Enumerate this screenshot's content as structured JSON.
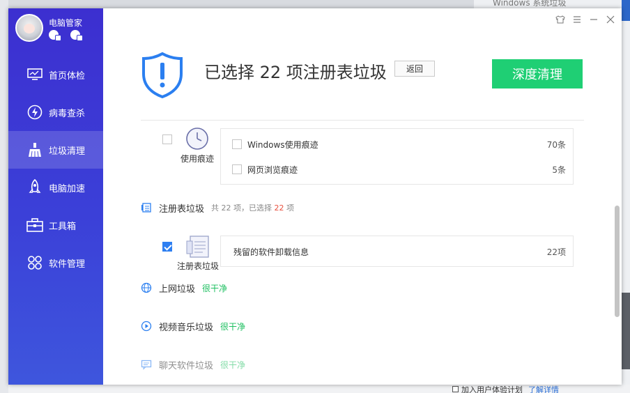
{
  "app": {
    "name": "电脑管家",
    "accent": "#3b3ad4",
    "green": "#1fcf74"
  },
  "sidebar": {
    "items": [
      {
        "label": "首页体检",
        "icon": "monitor-icon"
      },
      {
        "label": "病毒查杀",
        "icon": "lightning-icon"
      },
      {
        "label": "垃圾清理",
        "icon": "broom-icon",
        "active": true
      },
      {
        "label": "电脑加速",
        "icon": "rocket-icon"
      },
      {
        "label": "工具箱",
        "icon": "toolbox-icon"
      },
      {
        "label": "软件管理",
        "icon": "apps-icon"
      }
    ]
  },
  "header": {
    "title": "已选择 22 项注册表垃圾",
    "back_label": "返回",
    "deep_clean_label": "深度清理"
  },
  "usage_traces": {
    "label": "使用痕迹",
    "rows": [
      {
        "name": "Windows使用痕迹",
        "count": "70条"
      },
      {
        "name": "网页浏览痕迹",
        "count": "5条"
      }
    ]
  },
  "registry": {
    "title": "注册表垃圾",
    "summary_prefix": "共 22 项，已选择",
    "selected": "22",
    "summary_suffix": "项",
    "sub_label": "注册表垃圾",
    "rows": [
      {
        "name": "残留的软件卸载信息",
        "count": "22项"
      }
    ]
  },
  "categories": [
    {
      "name": "上网垃圾",
      "status": "很干净",
      "icon": "globe-icon"
    },
    {
      "name": "视频音乐垃圾",
      "status": "很干净",
      "icon": "play-icon"
    },
    {
      "name": "聊天软件垃圾",
      "status": "很干净",
      "icon": "chat-icon"
    }
  ],
  "background": {
    "top_title": "Windows 系统垃圾",
    "bottom_checkbox": "加入用户体验计划",
    "bottom_link": "了解详情"
  }
}
